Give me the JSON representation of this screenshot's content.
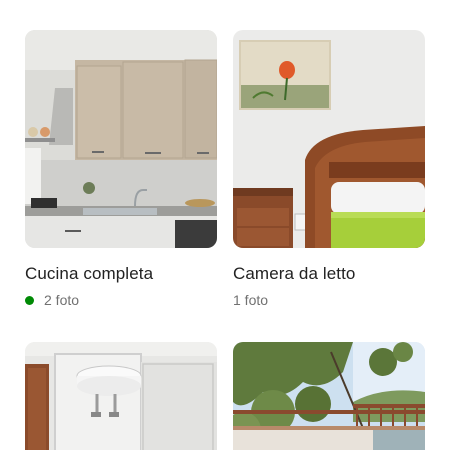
{
  "accent_color": "#008a05",
  "rooms": [
    {
      "id": "kitchen",
      "title": "Cucina completa",
      "photo_count_text": "2 foto",
      "has_status_dot": true,
      "status_dot_color": "#008a05"
    },
    {
      "id": "bedroom",
      "title": "Camera da letto",
      "photo_count_text": "1 foto",
      "has_status_dot": false
    },
    {
      "id": "bathroom"
    },
    {
      "id": "terrace"
    }
  ]
}
